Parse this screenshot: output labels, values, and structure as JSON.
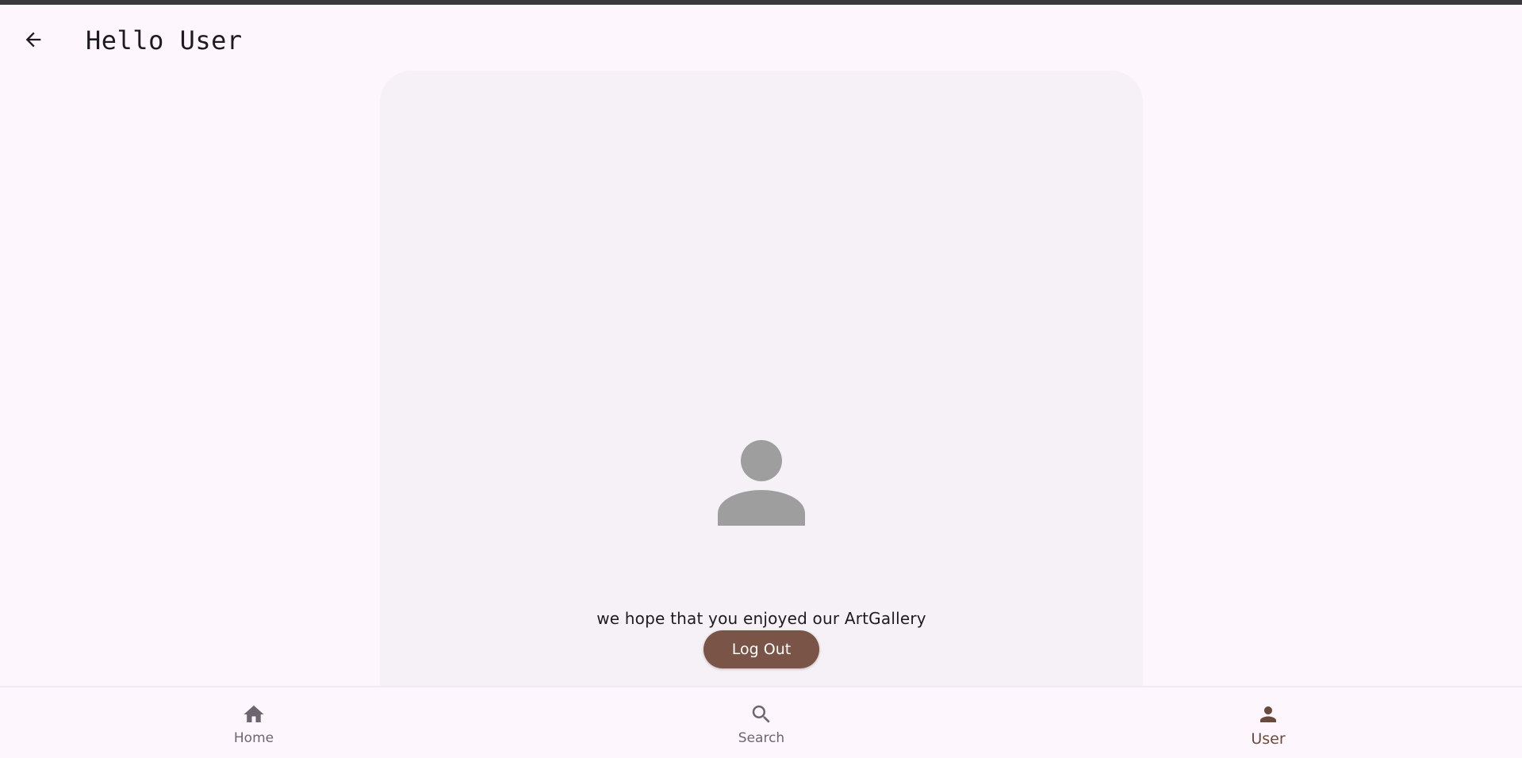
{
  "appbar": {
    "title": "Hello User",
    "back_icon": "arrow-left-icon"
  },
  "card": {
    "avatar_icon": "person-icon",
    "message": "we hope that you enjoyed our ArtGallery",
    "logout_label": "Log Out"
  },
  "bottom_nav": {
    "items": [
      {
        "label": "Home",
        "icon": "home-icon",
        "active": false
      },
      {
        "label": "Search",
        "icon": "search-icon",
        "active": false
      },
      {
        "label": "User",
        "icon": "person-icon",
        "active": true
      }
    ]
  },
  "colors": {
    "background": "#fdf7fd",
    "card": "#f5f1f7",
    "accent": "#7a5446",
    "active_nav": "#6b4a3e",
    "inactive_nav": "#6b6670"
  }
}
